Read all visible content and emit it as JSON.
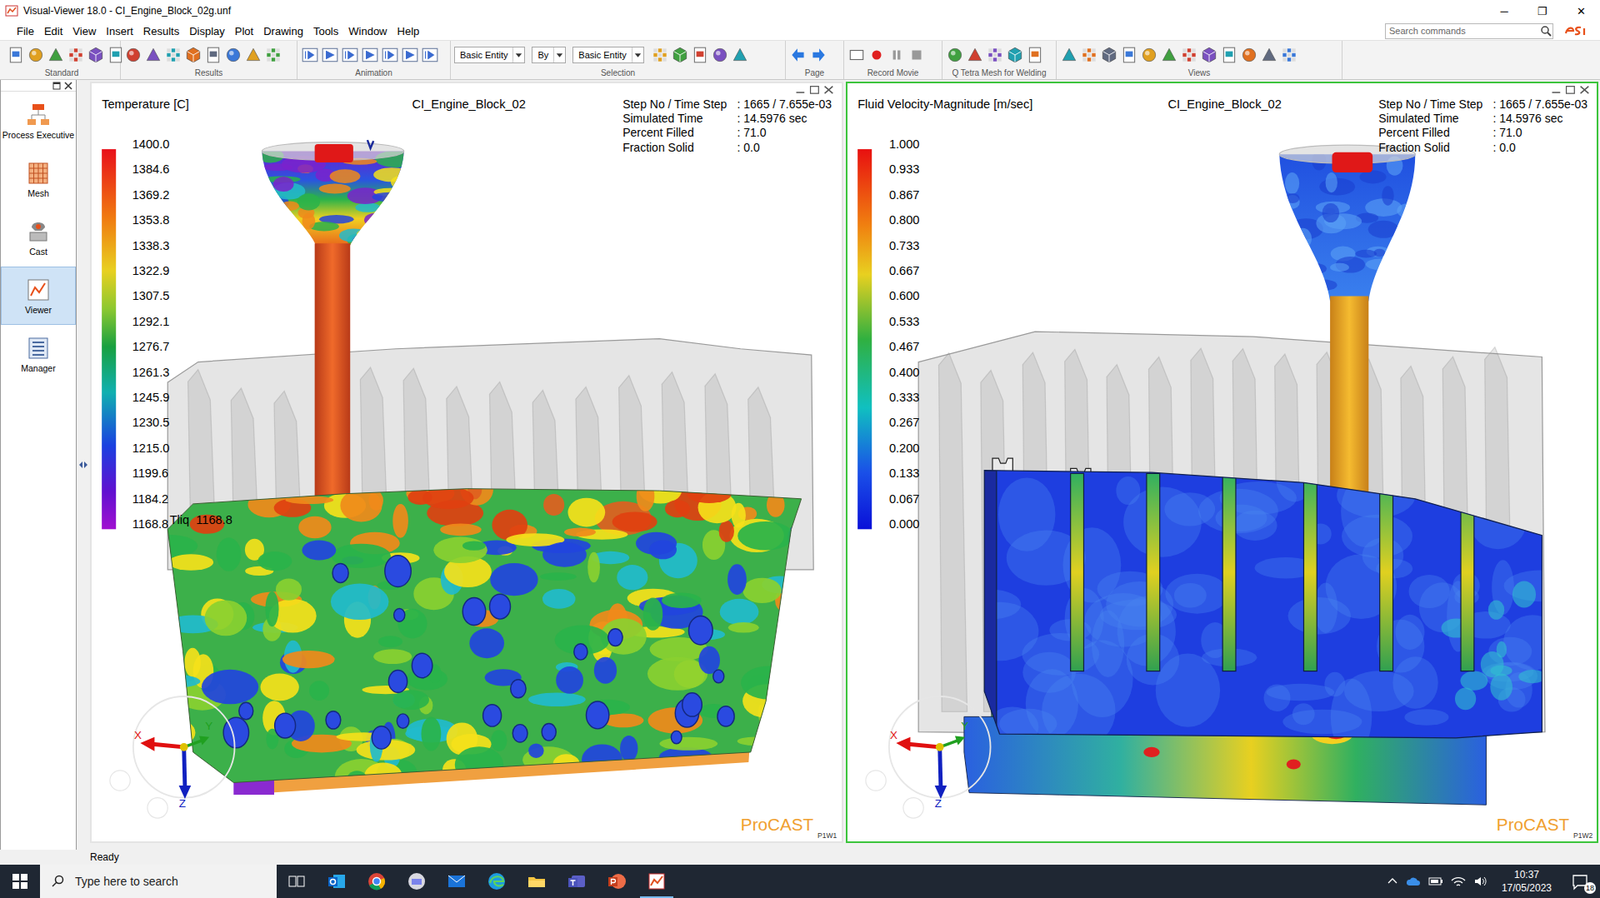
{
  "window": {
    "title": "Visual-Viewer 18.0 - CI_Engine_Block_02g.unf",
    "controls": [
      "─",
      "❐",
      "✕"
    ]
  },
  "menu": [
    "File",
    "Edit",
    "View",
    "Insert",
    "Results",
    "Display",
    "Plot",
    "Drawing",
    "Tools",
    "Window",
    "Help"
  ],
  "search": {
    "placeholder": "Search commands"
  },
  "toolbar": {
    "groups": [
      "Standard",
      "Results",
      "Animation",
      "Selection",
      "Page",
      "Record Movie",
      "Q Tetra Mesh for Welding",
      "Views"
    ],
    "selection_fields": [
      "Basic Entity",
      "By",
      "Basic Entity"
    ]
  },
  "sidebar": {
    "items": [
      {
        "label": "Process Executive",
        "selected": false
      },
      {
        "label": "Mesh",
        "selected": false
      },
      {
        "label": "Cast",
        "selected": false
      },
      {
        "label": "Viewer",
        "selected": true
      },
      {
        "label": "Manager",
        "selected": false
      }
    ]
  },
  "viewports": [
    {
      "quantity": "Temperature [C]",
      "model": "CI_Engine_Block_02",
      "active": false,
      "info": [
        {
          "label": "Step No / Time Step",
          "value": ": 1665 / 7.655e-03"
        },
        {
          "label": "Simulated Time",
          "value": ": 14.5976 sec"
        },
        {
          "label": "Percent Filled",
          "value": ": 71.0"
        },
        {
          "label": "Fraction Solid",
          "value": ": 0.0"
        }
      ],
      "legend": [
        "1400.0",
        "1384.6",
        "1369.2",
        "1353.8",
        "1338.3",
        "1322.9",
        "1307.5",
        "1292.1",
        "1276.7",
        "1261.3",
        "1245.9",
        "1230.5",
        "1215.0",
        "1199.6",
        "1184.2",
        "1168.8"
      ],
      "marker": "Tliq  1168.8",
      "axes": [
        "X",
        "Y",
        "Z"
      ],
      "brand": "ProCAST",
      "window_id": "P1W1"
    },
    {
      "quantity": "Fluid Velocity-Magnitude [m/sec]",
      "model": "CI_Engine_Block_02",
      "active": true,
      "info": [
        {
          "label": "Step No / Time Step",
          "value": ": 1665 / 7.655e-03"
        },
        {
          "label": "Simulated Time",
          "value": ": 14.5976 sec"
        },
        {
          "label": "Percent Filled",
          "value": ": 71.0"
        },
        {
          "label": "Fraction Solid",
          "value": ": 0.0"
        }
      ],
      "legend": [
        "1.000",
        "0.933",
        "0.867",
        "0.800",
        "0.733",
        "0.667",
        "0.600",
        "0.533",
        "0.467",
        "0.400",
        "0.333",
        "0.267",
        "0.200",
        "0.133",
        "0.067",
        "0.000"
      ],
      "axes": [
        "X",
        "Y",
        "Z"
      ],
      "brand": "ProCAST",
      "window_id": "P1W2"
    }
  ],
  "status_bar": "Ready",
  "taskbar": {
    "search_placeholder": "Type here to search",
    "time": "10:37",
    "date": "17/05/2023",
    "notifications": "18"
  }
}
